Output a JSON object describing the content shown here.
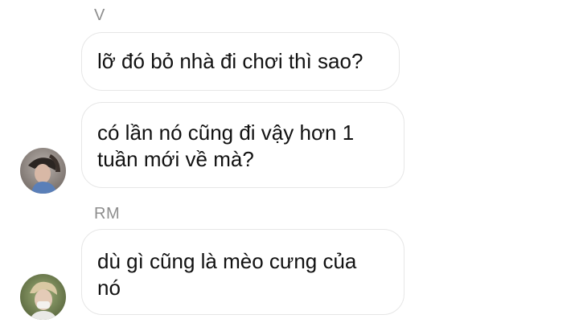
{
  "thread": {
    "groups": [
      {
        "sender": "V",
        "messages": [
          {
            "lines": [
              "lỡ đó bỏ nhà đi chơi thì sao?"
            ]
          },
          {
            "lines": [
              "có lần nó cũng đi vậy hơn 1",
              "tuần mới về mà?"
            ]
          }
        ],
        "avatar_icon": "profile-photo-v"
      },
      {
        "sender": "RM",
        "messages": [
          {
            "lines": [
              "dù gì cũng là mèo cưng của",
              "nó"
            ]
          }
        ],
        "avatar_icon": "profile-photo-rm"
      }
    ]
  },
  "colors": {
    "bubble_border": "#e6e6e6",
    "sender_label": "#8e8e8e",
    "text": "#111111"
  }
}
